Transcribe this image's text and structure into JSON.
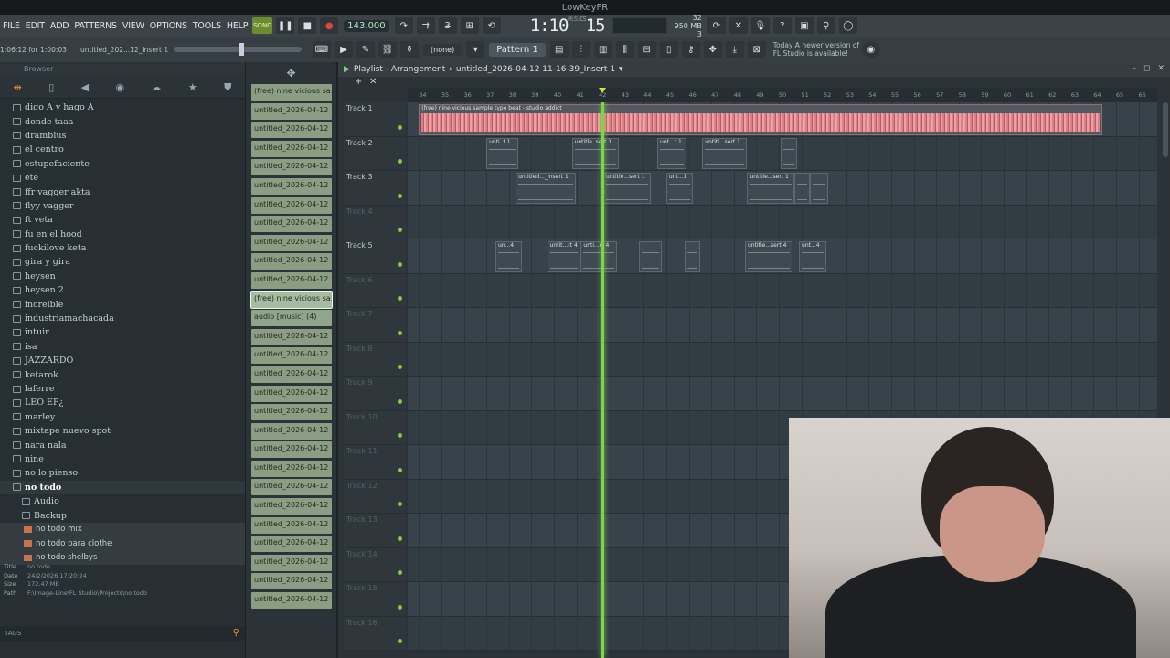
{
  "window": {
    "title": "LowKeyFR"
  },
  "menu": [
    "FILE",
    "EDIT",
    "ADD",
    "PATTERNS",
    "VIEW",
    "OPTIONS",
    "TOOLS",
    "HELP"
  ],
  "transport": {
    "song_label": "SONG",
    "bpm": "143.000",
    "time": "1:10",
    "time_frac": "15",
    "time_unit": "M:S:CS"
  },
  "status": {
    "cpu": "32",
    "memory": "950 MB",
    "polyphony": "3"
  },
  "hint": {
    "position": "1:06:12 for 1:00:03",
    "project_short": "untitled_202...12_Insert 1"
  },
  "toolbar2": {
    "none_label": "(none)",
    "pattern": "Pattern 1"
  },
  "notice": {
    "line1": "Today  A newer version of",
    "line2": "FL Studio is available!"
  },
  "browser": {
    "header": "Browser",
    "folders": [
      "digo A y hago A",
      "donde taaa",
      "dramblus",
      "el centro",
      "estupefaciente",
      "ete",
      "ffr vagger akta",
      "flyy vagger",
      "ft veta",
      "fu en el hood",
      "fuckilove keta",
      "gira y gira",
      "heysen",
      "heysen 2",
      "increible",
      "industriamachacada",
      "intuir",
      "isa",
      "JAZZARDO",
      "ketarok",
      "laferre",
      "LEO EP¿",
      "marley",
      "mixtape nuevo spot",
      "nara nala",
      "nine",
      "no lo pienso"
    ],
    "open_folder": "no todo",
    "subfolders": [
      "Audio",
      "Backup"
    ],
    "files": [
      "no todo mix",
      "no todo para clothe",
      "no todo shelbys"
    ],
    "info": {
      "title_label": "Title",
      "title": "no todo",
      "date_label": "Date",
      "date": "24/2/2026 17:20:24",
      "size_label": "Size",
      "size": "172.47 MB",
      "path_label": "Path",
      "path": "F:\\Image-Line\\FL Studio\\Projects\\no todo"
    },
    "tags_label": "TAGS"
  },
  "picker": {
    "clips": [
      "(free) nine vicious sa...",
      "untitled_2026-04-12 10-...",
      "untitled_2026-04-12 10-...",
      "untitled_2026-04-12 10-...",
      "untitled_2026-04-12 10-...",
      "untitled_2026-04-12 10-...",
      "untitled_2026-04-12 10-...",
      "untitled_2026-04-12 10-...",
      "untitled_2026-04-12 10-...",
      "untitled_2026-04-12 10-...",
      "untitled_2026-04-12 10-...",
      "(free) nine vicious sa...",
      "audio [music] (4)",
      "untitled_2026-04-12 10-...",
      "untitled_2026-04-12 10-...",
      "untitled_2026-04-12 10-...",
      "untitled_2026-04-12 10-...",
      "untitled_2026-04-12 10-...",
      "untitled_2026-04-12 10-...",
      "untitled_2026-04-12 10-...",
      "untitled_2026-04-12 10-...",
      "untitled_2026-04-12 10-...",
      "untitled_2026-04-12 10-...",
      "untitled_2026-04-12 10-...",
      "untitled_2026-04-12 10-...",
      "untitled_2026-04-12 10-...",
      "untitled_2026-04-12 10-...",
      "untitled_2026-04-12 10-..."
    ]
  },
  "playlist": {
    "title": "Playlist - Arrangement",
    "project": "untitled_2026-04-12 11-16-39_Insert 1",
    "ruler": [
      "34",
      "35",
      "36",
      "37",
      "38",
      "39",
      "40",
      "41",
      "42",
      "43",
      "44",
      "45",
      "46",
      "47",
      "48",
      "49",
      "50",
      "51",
      "52",
      "53",
      "54",
      "55",
      "56",
      "57",
      "58",
      "59",
      "60",
      "61",
      "62",
      "63",
      "64",
      "65",
      "66"
    ],
    "tracks": [
      "Track 1",
      "Track 2",
      "Track 3",
      "Track 4",
      "Track 5",
      "Track 6",
      "Track 7",
      "Track 8",
      "Track 9",
      "Track 10",
      "Track 11",
      "Track 12",
      "Track 13",
      "Track 14",
      "Track 15",
      "Track 16"
    ],
    "playhead_bar": 42.1,
    "clips": [
      {
        "track": 1,
        "start": 34,
        "end": 64.4,
        "label": "(free) nine vicious sample type beat - studio addict",
        "main": true
      },
      {
        "track": 2,
        "start": 37,
        "end": 38.4,
        "label": "unti..t 1"
      },
      {
        "track": 2,
        "start": 40.8,
        "end": 42.9,
        "label": "untitle..sert 1"
      },
      {
        "track": 2,
        "start": 44.6,
        "end": 45.9,
        "label": "unt...t 1"
      },
      {
        "track": 2,
        "start": 46.6,
        "end": 48.6,
        "label": "untitl...sert 1"
      },
      {
        "track": 2,
        "start": 50.1,
        "end": 50.8,
        "label": ""
      },
      {
        "track": 3,
        "start": 38.3,
        "end": 41,
        "label": "untitled..._Insert 1"
      },
      {
        "track": 3,
        "start": 42.2,
        "end": 44.3,
        "label": "untitle...sert 1"
      },
      {
        "track": 3,
        "start": 45,
        "end": 46.2,
        "label": "unt...1"
      },
      {
        "track": 3,
        "start": 48.6,
        "end": 50.7,
        "label": "untitle...sert 1"
      },
      {
        "track": 3,
        "start": 50.7,
        "end": 51.4,
        "label": ""
      },
      {
        "track": 3,
        "start": 51.4,
        "end": 52.2,
        "label": ""
      },
      {
        "track": 5,
        "start": 37.4,
        "end": 38.6,
        "label": "un...4"
      },
      {
        "track": 5,
        "start": 39.7,
        "end": 41.2,
        "label": "untit...rt 4"
      },
      {
        "track": 5,
        "start": 41.2,
        "end": 42.8,
        "label": "unti...rt 4"
      },
      {
        "track": 5,
        "start": 43.8,
        "end": 44.8,
        "label": ""
      },
      {
        "track": 5,
        "start": 45.8,
        "end": 46.5,
        "label": ""
      },
      {
        "track": 5,
        "start": 48.5,
        "end": 50.6,
        "label": "untitle...sert 4"
      },
      {
        "track": 5,
        "start": 50.9,
        "end": 52.1,
        "label": "unt...4"
      }
    ]
  }
}
